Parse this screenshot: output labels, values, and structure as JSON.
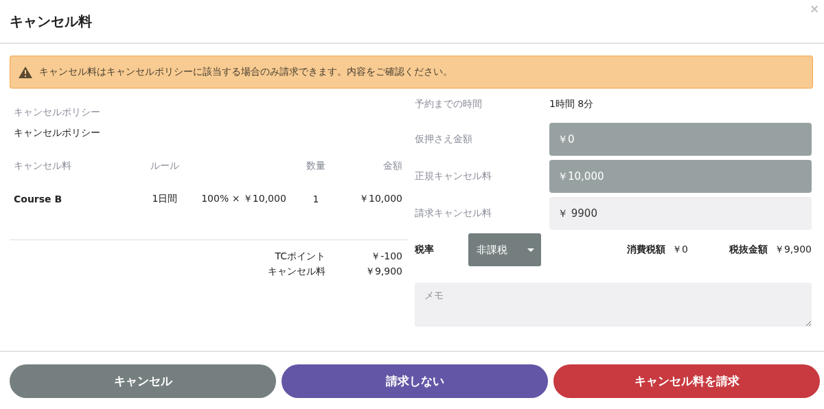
{
  "dialog": {
    "title": "キャンセル料",
    "close": "×"
  },
  "alert": {
    "text": "キャンセル料はキャンセルポリシーに該当する場合のみ請求できます。内容をご確認ください。"
  },
  "policy": {
    "label": "キャンセルポリシー",
    "value": "キャンセルポリシー"
  },
  "fee_table": {
    "columns": [
      "キャンセル料",
      "ルール",
      "数量",
      "金額"
    ],
    "rows": [
      {
        "name": "Course B",
        "rule": "1日間",
        "formula": "100% × ￥10,000",
        "quantity": "1",
        "amount": "￥10,000"
      }
    ]
  },
  "totals": [
    {
      "label": "TCポイント",
      "value": "￥-100"
    },
    {
      "label": "キャンセル料",
      "value": "￥9,900"
    }
  ],
  "time_until": {
    "label": "予約までの時間",
    "value": "1時間 8分"
  },
  "fields": [
    {
      "label": "仮押さえ金額",
      "value": "￥0",
      "disabled": true
    },
    {
      "label": "正規キャンセル料",
      "value": "￥10,000",
      "disabled": true
    },
    {
      "label": "請求キャンセル料",
      "value": "￥ 9900",
      "disabled": false
    }
  ],
  "tax": {
    "label": "税率",
    "select": "非課税",
    "consumption_label": "消費税額",
    "consumption_value": "￥0",
    "net_label": "税抜金額",
    "net_value": "￥9,900"
  },
  "memo": {
    "placeholder": "メモ"
  },
  "buttons": [
    {
      "label": "キャンセル",
      "kind": "neutral"
    },
    {
      "label": "請求しない",
      "kind": "secondary"
    },
    {
      "label": "キャンセル料を請求",
      "kind": "danger"
    }
  ]
}
